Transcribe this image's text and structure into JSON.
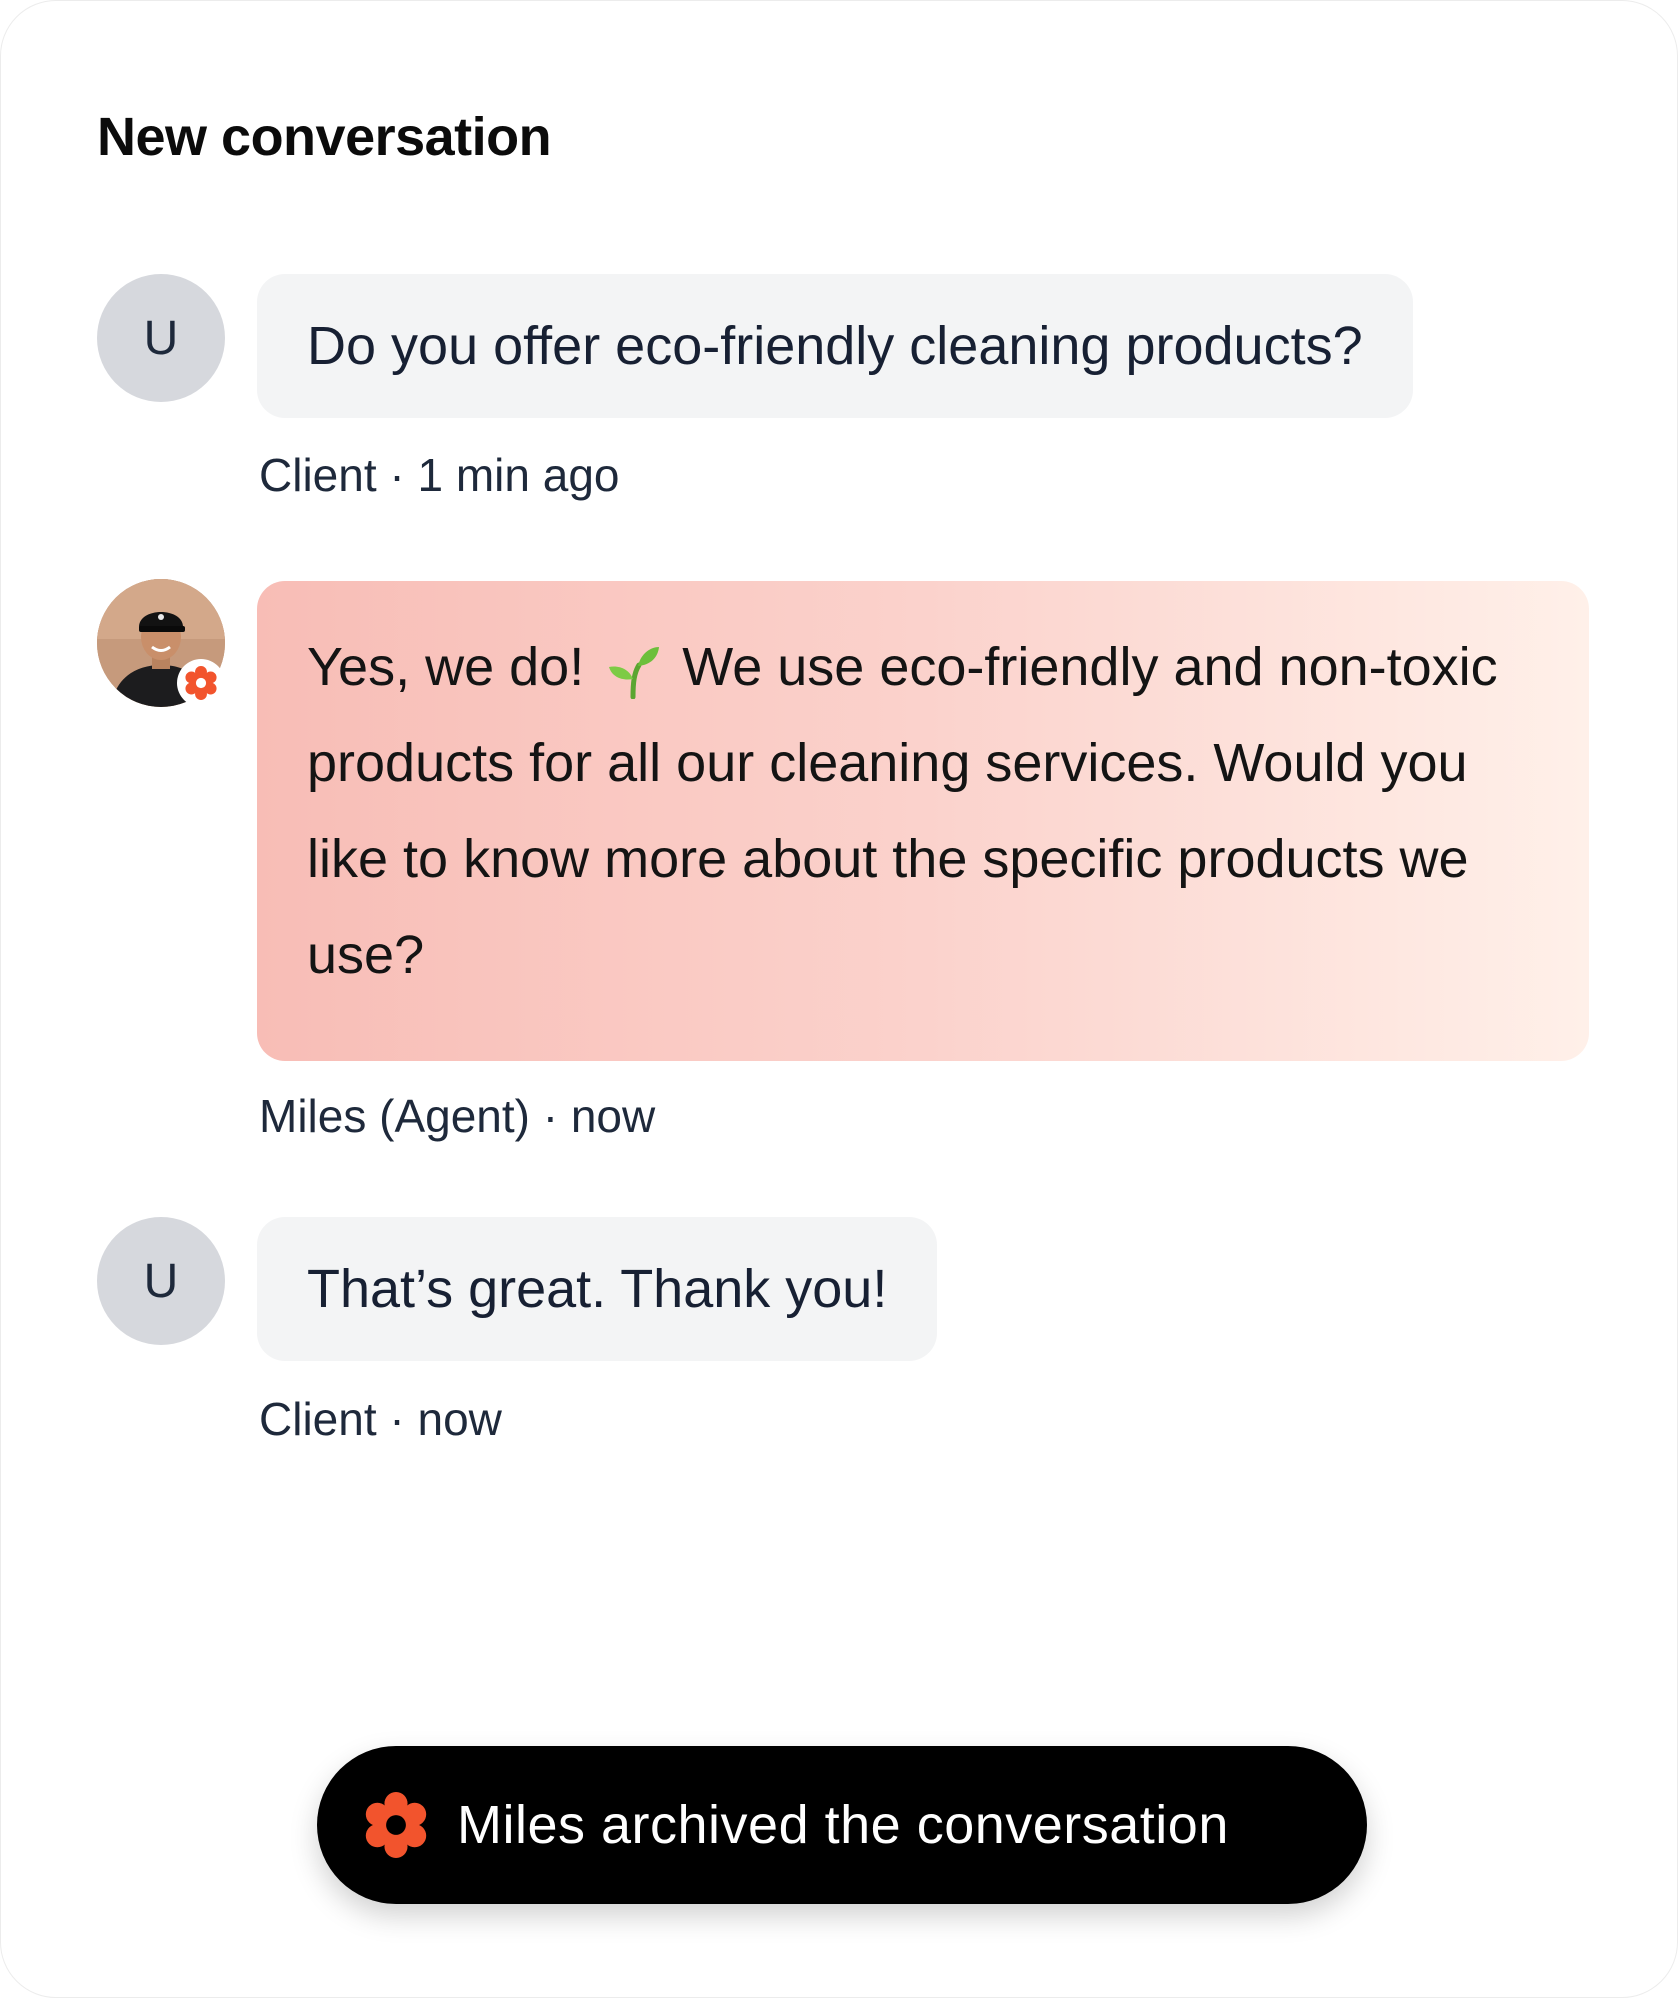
{
  "header": {
    "title": "New conversation"
  },
  "messages": [
    {
      "avatar_initial": "U",
      "text": "Do you offer eco-friendly cleaning products?",
      "meta": "Client · 1 min ago"
    },
    {
      "avatar_icon": "agent-photo-avatar",
      "badge_icon": "brand-flower-icon",
      "text_part1": "Yes, we do!",
      "emoji_icon": "seedling-icon",
      "text_part2": "We use eco-friendly and non-toxic products for all our cleaning services. Would you like to know more about the specific products we use?",
      "meta": "Miles (Agent) · now"
    },
    {
      "avatar_initial": "U",
      "text": "That’s great. Thank you!",
      "meta": "Client · now"
    }
  ],
  "toast": {
    "icon": "brand-flower-icon",
    "text": "Miles archived the conversation"
  },
  "colors": {
    "brand": "#f2542d",
    "avatar_bg": "#d6d8dd",
    "client_bubble": "#f3f4f5",
    "agent_bubble_start": "#f8bdb6",
    "agent_bubble_end": "#fff0e9",
    "toast_bg": "#000000"
  }
}
